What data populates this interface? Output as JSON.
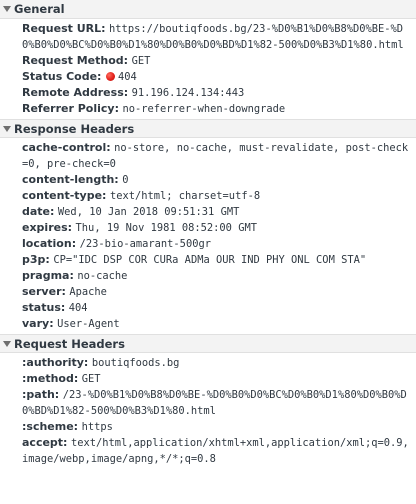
{
  "general": {
    "title": "General",
    "rows": [
      {
        "key": "Request URL:",
        "value": "https://boutiqfoods.bg/23-%D0%B1%D0%B8%D0%BE-%D0%B0%D0%BC%D0%B0%D1%80%D0%B0%D0%BD%D1%82-500%D0%B3%D1%80.html"
      },
      {
        "key": "Request Method:",
        "value": "GET"
      },
      {
        "key": "Status Code:",
        "value": "404",
        "status_color": "#e3211b"
      },
      {
        "key": "Remote Address:",
        "value": "91.196.124.134:443"
      },
      {
        "key": "Referrer Policy:",
        "value": "no-referrer-when-downgrade"
      }
    ]
  },
  "response_headers": {
    "title": "Response Headers",
    "rows": [
      {
        "key": "cache-control:",
        "value": "no-store, no-cache, must-revalidate, post-check=0, pre-check=0"
      },
      {
        "key": "content-length:",
        "value": "0"
      },
      {
        "key": "content-type:",
        "value": "text/html; charset=utf-8"
      },
      {
        "key": "date:",
        "value": "Wed, 10 Jan 2018 09:51:31 GMT"
      },
      {
        "key": "expires:",
        "value": "Thu, 19 Nov 1981 08:52:00 GMT"
      },
      {
        "key": "location:",
        "value": "/23-bio-amarant-500gr"
      },
      {
        "key": "p3p:",
        "value": "CP=\"IDC DSP COR CURa ADMa OUR IND PHY ONL COM STA\""
      },
      {
        "key": "pragma:",
        "value": "no-cache"
      },
      {
        "key": "server:",
        "value": "Apache"
      },
      {
        "key": "status:",
        "value": "404"
      },
      {
        "key": "vary:",
        "value": "User-Agent"
      }
    ]
  },
  "request_headers": {
    "title": "Request Headers",
    "rows": [
      {
        "key": ":authority:",
        "value": "boutiqfoods.bg"
      },
      {
        "key": ":method:",
        "value": "GET"
      },
      {
        "key": ":path:",
        "value": "/23-%D0%B1%D0%B8%D0%BE-%D0%B0%D0%BC%D0%B0%D1%80%D0%B0%D0%BD%D1%82-500%D0%B3%D1%80.html"
      },
      {
        "key": ":scheme:",
        "value": "https"
      },
      {
        "key": "accept:",
        "value": "text/html,application/xhtml+xml,application/xml;q=0.9,image/webp,image/apng,*/*;q=0.8"
      }
    ]
  }
}
